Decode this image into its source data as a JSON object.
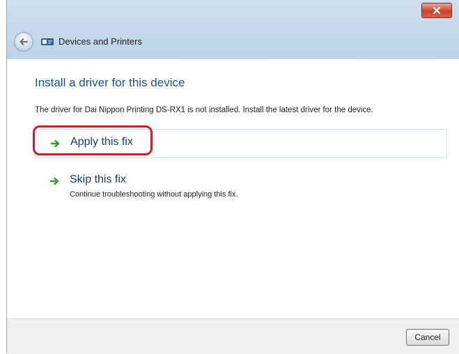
{
  "window": {
    "breadcrumb": "Devices and Printers"
  },
  "main": {
    "title": "Install a driver for this device",
    "description": "The driver for Dai Nippon Printing DS-RX1 is not installed. Install the latest driver for the device.",
    "options": [
      {
        "label": "Apply this fix",
        "icon": "green-arrow-icon",
        "highlighted": true
      },
      {
        "label": "Skip this fix",
        "sublabel": "Continue troubleshooting without applying this fix.",
        "icon": "green-arrow-icon"
      }
    ]
  },
  "footer": {
    "cancel_label": "Cancel"
  },
  "colors": {
    "title": "#1f4e9a",
    "highlight": "#cc1f26",
    "arrow": "#2e9e2e"
  }
}
